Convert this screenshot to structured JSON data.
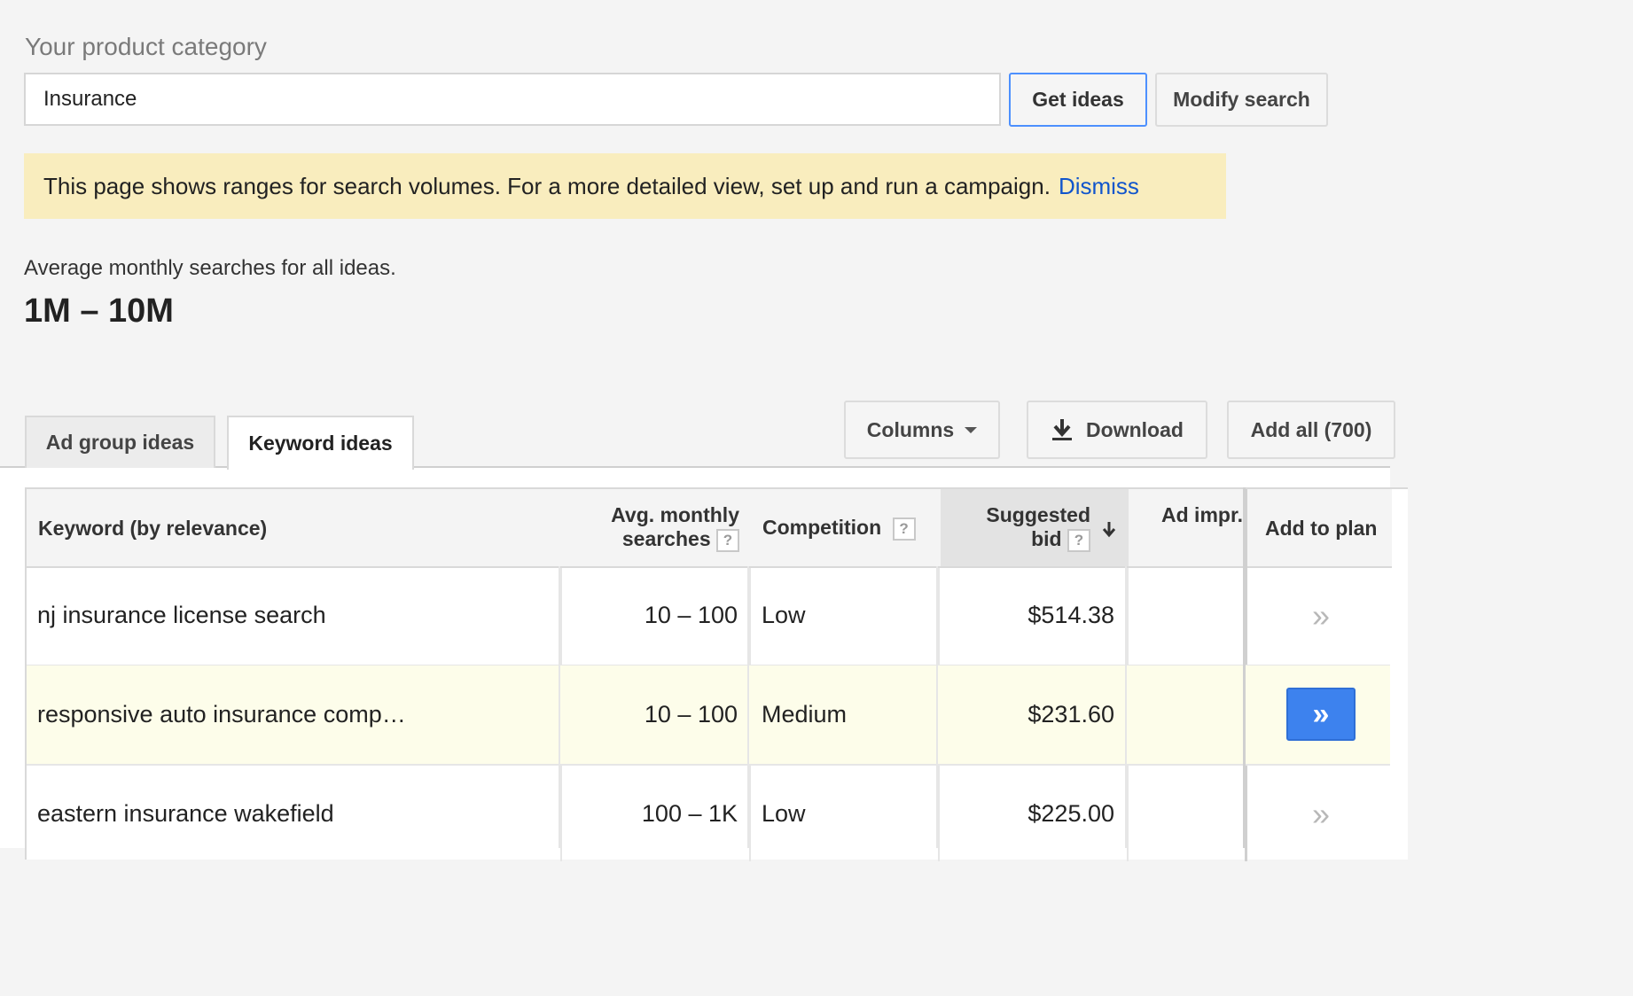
{
  "search": {
    "label": "Your product category",
    "value": "Insurance",
    "get_ideas_label": "Get ideas",
    "modify_search_label": "Modify search"
  },
  "notice": {
    "text": "This page shows ranges for search volumes. For a more detailed view, set up and run a campaign.",
    "dismiss_label": "Dismiss",
    "background_color": "#f9edbe",
    "link_color": "#1155cc"
  },
  "summary": {
    "label": "Average monthly searches for all ideas.",
    "value": "1M – 10M"
  },
  "tabs": [
    {
      "label": "Ad group ideas",
      "active": false
    },
    {
      "label": "Keyword ideas",
      "active": true
    }
  ],
  "toolbar": {
    "columns_label": "Columns",
    "download_label": "Download",
    "add_all_label": "Add all (700)"
  },
  "table": {
    "headers": {
      "keyword": "Keyword (by relevance)",
      "avg_line1": "Avg. monthly",
      "avg_line2": "searches",
      "competition": "Competition",
      "bid_line1": "Suggested",
      "bid_line2": "bid",
      "ad_impr": "Ad impr.",
      "add_to_plan": "Add to plan",
      "help_glyph": "?",
      "sort_icon": "arrow-down-icon"
    },
    "rows": [
      {
        "keyword": "nj insurance license search",
        "searches": "10 – 100",
        "competition": "Low",
        "bid": "$514.38",
        "add_glyph": "»",
        "highlighted": false
      },
      {
        "keyword": "responsive auto insurance comp…",
        "searches": "10 – 100",
        "competition": "Medium",
        "bid": "$231.60",
        "add_glyph": "»",
        "highlighted": true
      },
      {
        "keyword": "eastern insurance wakefield",
        "searches": "100 – 1K",
        "competition": "Low",
        "bid": "$225.00",
        "add_glyph": "»",
        "highlighted": false
      }
    ],
    "highlight_color": "#fdfdea",
    "add_button_color": "#3d82ee"
  }
}
